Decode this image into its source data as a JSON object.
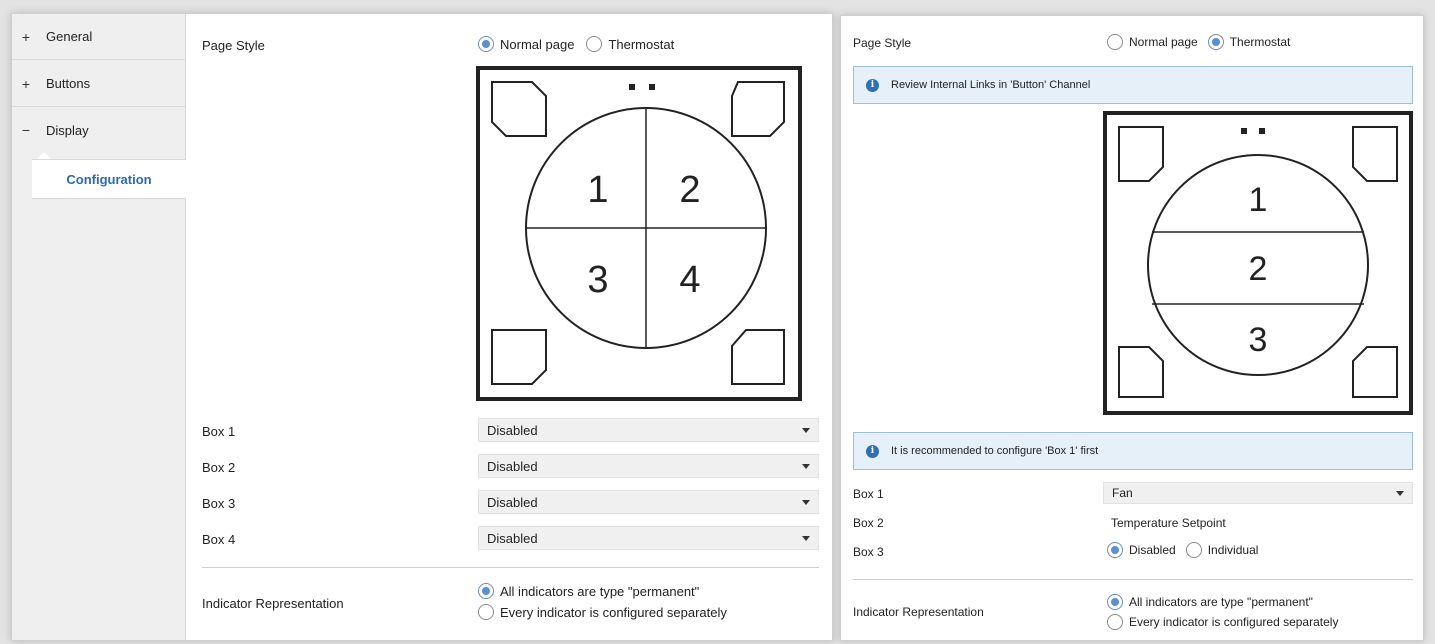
{
  "left_window": {
    "sidebar": {
      "items": [
        {
          "sign": "+",
          "label": "General"
        },
        {
          "sign": "+",
          "label": "Buttons"
        },
        {
          "sign": "−",
          "label": "Display"
        }
      ],
      "sub_item": "Configuration"
    },
    "page_style": {
      "label": "Page Style",
      "options": [
        "Normal page",
        "Thermostat"
      ],
      "selected": "Normal page"
    },
    "pad": {
      "numbers": [
        "1",
        "2",
        "3",
        "4"
      ]
    },
    "boxes": [
      {
        "label": "Box 1",
        "value": "Disabled"
      },
      {
        "label": "Box 2",
        "value": "Disabled"
      },
      {
        "label": "Box 3",
        "value": "Disabled"
      },
      {
        "label": "Box 4",
        "value": "Disabled"
      }
    ],
    "indicator": {
      "label": "Indicator Representation",
      "options": [
        "All indicators are type \"permanent\"",
        "Every indicator is configured separately"
      ],
      "selected": "All indicators are type \"permanent\""
    }
  },
  "right_window": {
    "page_style": {
      "label": "Page Style",
      "options": [
        "Normal page",
        "Thermostat"
      ],
      "selected": "Thermostat"
    },
    "info_top": "Review Internal Links in 'Button' Channel",
    "pad": {
      "numbers": [
        "1",
        "2",
        "3"
      ]
    },
    "info_bottom": "It is recommended to configure 'Box 1' first",
    "box1": {
      "label": "Box 1",
      "value": "Fan"
    },
    "box2": {
      "label": "Box 2",
      "value": "Temperature Setpoint"
    },
    "box3": {
      "label": "Box 3",
      "options": [
        "Disabled",
        "Individual"
      ],
      "selected": "Disabled"
    },
    "indicator": {
      "label": "Indicator Representation",
      "options": [
        "All indicators are type \"permanent\"",
        "Every indicator is configured separately"
      ],
      "selected": "All indicators are type \"permanent\""
    }
  },
  "colors": {
    "accent": "#2a6ab4",
    "info_bg": "#e6f0f9",
    "info_border": "#9dbddb",
    "radio_on": "#5b8fd0"
  },
  "icons": [
    "info-icon",
    "dropdown-caret-icon",
    "radio-icon"
  ]
}
